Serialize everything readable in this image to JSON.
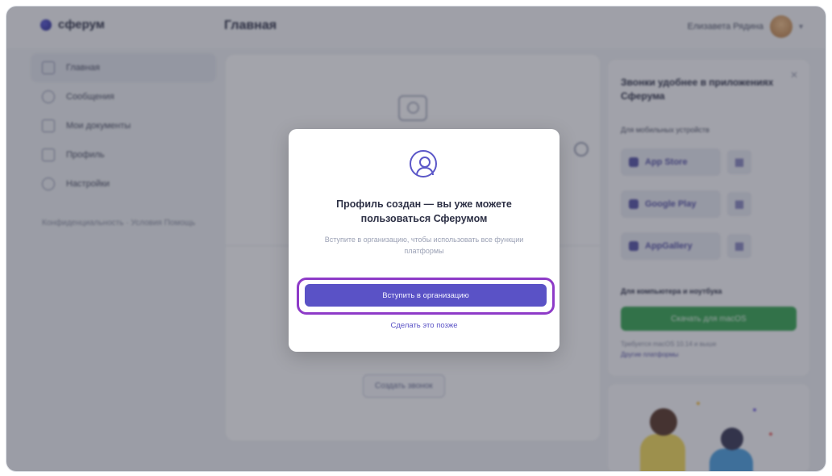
{
  "app": {
    "logo_text": "сферум",
    "page_title": "Главная"
  },
  "user": {
    "name": "Елизавета Рядина"
  },
  "sidebar": {
    "items": [
      {
        "label": "Главная",
        "icon": "home-icon"
      },
      {
        "label": "Сообщения",
        "icon": "chat-icon"
      },
      {
        "label": "Мои документы",
        "icon": "document-icon"
      },
      {
        "label": "Профиль",
        "icon": "profile-icon"
      },
      {
        "label": "Настройки",
        "icon": "settings-icon"
      }
    ],
    "footer": "Конфиденциальность · Условия Помощь"
  },
  "main": {
    "create_call_button": "Создать звонок"
  },
  "right_panel": {
    "title": "Звонки удобнее в приложениях Сферума",
    "mobile_label": "Для мобильных устройств",
    "stores": [
      {
        "label": "App Store",
        "icon": "apple-icon"
      },
      {
        "label": "Google Play",
        "icon": "play-icon"
      },
      {
        "label": "AppGallery",
        "icon": "appgallery-icon"
      }
    ],
    "desktop_label": "Для компьютера и ноутбука",
    "download_button": "Скачать для macOS",
    "small_text": "Требуется macOS 10.14 и выше",
    "other_platforms_link": "Другие платформы"
  },
  "modal": {
    "title": "Профиль создан — вы уже можете пользоваться Сферумом",
    "text": "Вступите в организацию, чтобы использовать все функции платформы",
    "primary_button": "Вступить в организацию",
    "secondary_button": "Сделать это позже"
  },
  "colors": {
    "accent": "#5a52c6",
    "highlight": "#8e3bc8",
    "green": "#3aa655"
  }
}
